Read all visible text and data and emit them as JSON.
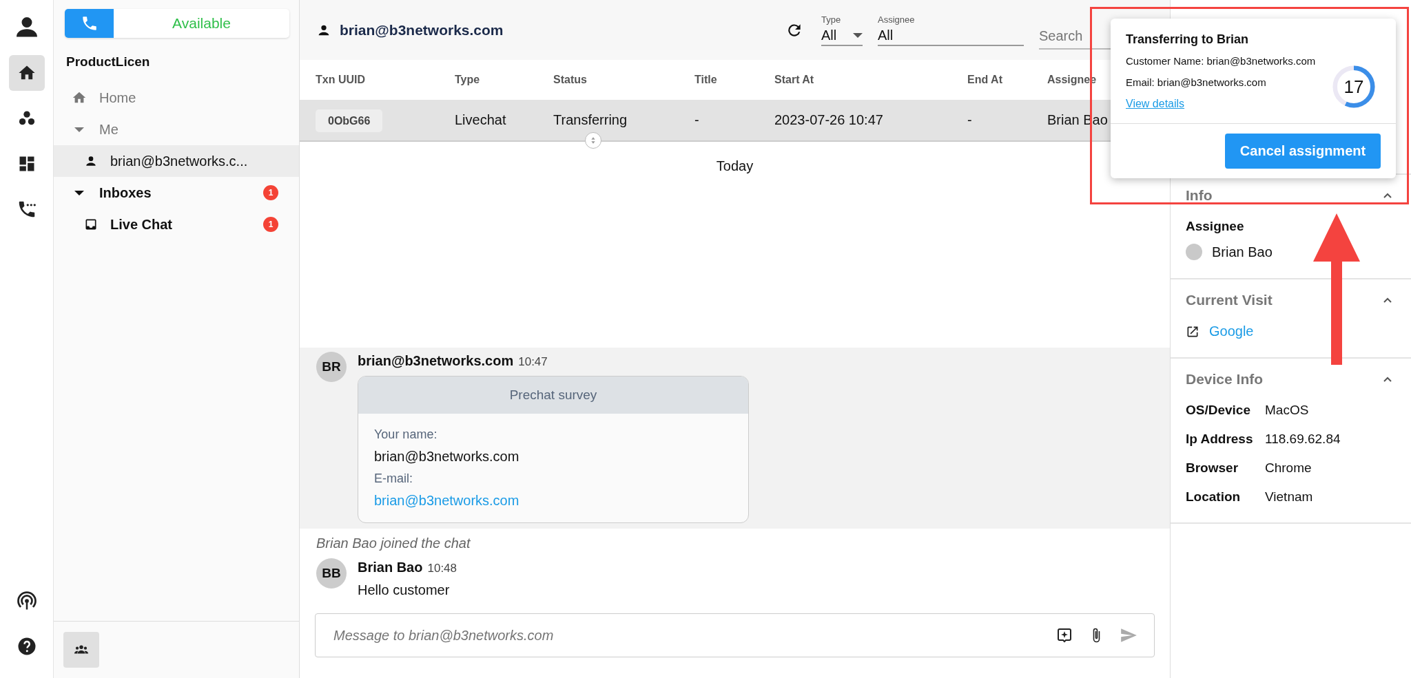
{
  "rail": {
    "top": [
      {
        "kind": "profile",
        "selected": false
      },
      {
        "kind": "home",
        "selected": true
      },
      {
        "kind": "groups",
        "selected": false
      },
      {
        "kind": "dashboard",
        "selected": false
      },
      {
        "kind": "calls",
        "selected": false
      }
    ],
    "bottom": [
      {
        "kind": "broadcast",
        "selected": false
      },
      {
        "kind": "help",
        "selected": false
      }
    ]
  },
  "status": {
    "label": "Available"
  },
  "sidebar": {
    "org": "ProductLicen",
    "items": [
      {
        "kind": "link",
        "label": "Home"
      },
      {
        "kind": "group",
        "label": "Me",
        "expanded": true,
        "bold": false,
        "children": [
          {
            "kind": "person",
            "label": "brian@b3networks.c...",
            "selected": true
          }
        ]
      },
      {
        "kind": "group",
        "label": "Inboxes",
        "expanded": true,
        "bold": true,
        "badge": "1",
        "children": [
          {
            "kind": "inbox",
            "label": "Live Chat",
            "badge": "1",
            "selected": false
          }
        ]
      }
    ]
  },
  "header": {
    "contact": "brian@b3networks.com",
    "filters": [
      {
        "kind": "select",
        "label": "Type",
        "value": "All"
      },
      {
        "kind": "text",
        "label": "Assignee",
        "value": "All"
      }
    ],
    "search": {
      "placeholder": "Search"
    }
  },
  "table": {
    "columns": [
      "Txn UUID",
      "Type",
      "Status",
      "Title",
      "Start At",
      "End At",
      "Assignee"
    ],
    "rows": [
      {
        "selected": true,
        "cells": [
          "0ObG66",
          "Livechat",
          "Transferring",
          "-",
          "2023-07-26 10:47",
          "-",
          "Brian Bao"
        ]
      }
    ]
  },
  "chat": {
    "date": "Today",
    "messages": [
      {
        "kind": "message",
        "avatar": "BR",
        "sender": "brian@b3networks.com",
        "time": "10:47",
        "highlighted": true,
        "survey": {
          "title": "Prechat survey",
          "fields": [
            {
              "kind": "text",
              "label": "Your name:",
              "value": "brian@b3networks.com"
            },
            {
              "kind": "link",
              "label": "E-mail:",
              "value": "brian@b3networks.com"
            }
          ]
        }
      },
      {
        "kind": "event",
        "text": "Brian Bao joined the chat"
      },
      {
        "kind": "message",
        "avatar": "BB",
        "sender": "Brian Bao",
        "time": "10:48",
        "highlighted": false,
        "text": "Hello customer"
      }
    ],
    "composer": {
      "placeholder": "Message to brian@b3networks.com"
    }
  },
  "details": {
    "sections": [
      {
        "kind": "assignee",
        "title": "Info",
        "expanded": true,
        "label": "Assignee",
        "value": "Brian Bao"
      },
      {
        "kind": "visit",
        "title": "Current Visit",
        "expanded": true,
        "link": "Google"
      },
      {
        "kind": "device",
        "title": "Device Info",
        "expanded": true,
        "rows": [
          {
            "label": "OS/Device",
            "value": "MacOS"
          },
          {
            "label": "Ip Address",
            "value": "118.69.62.84"
          },
          {
            "label": "Browser",
            "value": "Chrome"
          },
          {
            "label": "Location",
            "value": "Vietnam"
          }
        ]
      }
    ]
  },
  "popover": {
    "title": "Transferring to Brian",
    "lines": [
      "Customer Name: brian@b3networks.com",
      "Email: brian@b3networks.com"
    ],
    "link": "View details",
    "countdown": {
      "value": "17",
      "level": 0.57
    },
    "button": "Cancel assignment"
  }
}
